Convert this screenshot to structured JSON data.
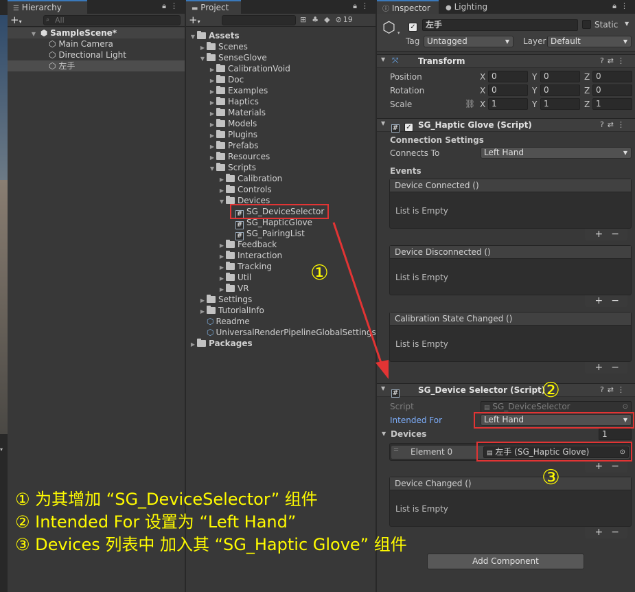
{
  "hierarchy": {
    "tab": "Hierarchy",
    "search_placeholder": "All",
    "scene": "SampleScene*",
    "items": [
      "Main Camera",
      "Directional Light",
      "左手"
    ]
  },
  "project": {
    "tab": "Project",
    "hidden_count": "19",
    "tree": [
      {
        "label": "Assets",
        "depth": 0,
        "expanded": true,
        "bold": true,
        "icon": "folder"
      },
      {
        "label": "Scenes",
        "depth": 1,
        "expanded": false,
        "icon": "folder"
      },
      {
        "label": "SenseGlove",
        "depth": 1,
        "expanded": true,
        "icon": "folder"
      },
      {
        "label": "CalibrationVoid",
        "depth": 2,
        "expanded": false,
        "icon": "folder"
      },
      {
        "label": "Doc",
        "depth": 2,
        "expanded": false,
        "icon": "folder"
      },
      {
        "label": "Examples",
        "depth": 2,
        "expanded": false,
        "icon": "folder"
      },
      {
        "label": "Haptics",
        "depth": 2,
        "expanded": false,
        "icon": "folder"
      },
      {
        "label": "Materials",
        "depth": 2,
        "expanded": false,
        "icon": "folder"
      },
      {
        "label": "Models",
        "depth": 2,
        "expanded": false,
        "icon": "folder"
      },
      {
        "label": "Plugins",
        "depth": 2,
        "expanded": false,
        "icon": "folder"
      },
      {
        "label": "Prefabs",
        "depth": 2,
        "expanded": false,
        "icon": "folder"
      },
      {
        "label": "Resources",
        "depth": 2,
        "expanded": false,
        "icon": "folder"
      },
      {
        "label": "Scripts",
        "depth": 2,
        "expanded": true,
        "icon": "folder"
      },
      {
        "label": "Calibration",
        "depth": 3,
        "expanded": false,
        "icon": "folder"
      },
      {
        "label": "Controls",
        "depth": 3,
        "expanded": false,
        "icon": "folder"
      },
      {
        "label": "Devices",
        "depth": 3,
        "expanded": true,
        "icon": "folder"
      },
      {
        "label": "SG_DeviceSelector",
        "depth": 4,
        "icon": "script"
      },
      {
        "label": "SG_HapticGlove",
        "depth": 4,
        "icon": "script"
      },
      {
        "label": "SG_PairingList",
        "depth": 4,
        "icon": "script"
      },
      {
        "label": "Feedback",
        "depth": 3,
        "expanded": false,
        "icon": "folder"
      },
      {
        "label": "Interaction",
        "depth": 3,
        "expanded": false,
        "icon": "folder"
      },
      {
        "label": "Tracking",
        "depth": 3,
        "expanded": false,
        "icon": "folder"
      },
      {
        "label": "Util",
        "depth": 3,
        "expanded": false,
        "icon": "folder"
      },
      {
        "label": "VR",
        "depth": 3,
        "expanded": false,
        "icon": "folder"
      },
      {
        "label": "Settings",
        "depth": 1,
        "expanded": false,
        "icon": "folder"
      },
      {
        "label": "TutorialInfo",
        "depth": 1,
        "expanded": false,
        "icon": "folder"
      },
      {
        "label": "Readme",
        "depth": 1,
        "icon": "asset"
      },
      {
        "label": "UniversalRenderPipelineGlobalSettings",
        "depth": 1,
        "icon": "asset"
      },
      {
        "label": "Packages",
        "depth": 0,
        "expanded": false,
        "bold": true,
        "icon": "folder"
      }
    ]
  },
  "inspector": {
    "tab": "Inspector",
    "tab2": "Lighting",
    "object_name": "左手",
    "static_label": "Static",
    "tag_label": "Tag",
    "tag_value": "Untagged",
    "layer_label": "Layer",
    "layer_value": "Default",
    "transform": {
      "title": "Transform",
      "rows": [
        {
          "label": "Position",
          "x": "0",
          "y": "0",
          "z": "0"
        },
        {
          "label": "Rotation",
          "x": "0",
          "y": "0",
          "z": "0"
        },
        {
          "label": "Scale",
          "x": "1",
          "y": "1",
          "z": "1"
        }
      ],
      "axis": [
        "X",
        "Y",
        "Z"
      ]
    },
    "haptic": {
      "title": "SG_Haptic Glove (Script)",
      "connection_settings": "Connection Settings",
      "connects_to_label": "Connects To",
      "connects_to_value": "Left Hand",
      "events_label": "Events",
      "events": [
        "Device Connected ()",
        "Device Disconnected ()",
        "Calibration State Changed ()"
      ],
      "empty": "List is Empty"
    },
    "selector": {
      "title": "SG_Device Selector (Script)",
      "script_label": "Script",
      "script_value": "SG_DeviceSelector",
      "intended_label": "Intended For",
      "intended_value": "Left Hand",
      "devices_label": "Devices",
      "devices_count": "1",
      "element_label": "Element 0",
      "element_value": "左手 (SG_Haptic Glove)",
      "event": "Device Changed ()",
      "empty": "List is Empty"
    },
    "add_component": "Add Component"
  },
  "annotations": {
    "markers": [
      "①",
      "②",
      "③"
    ],
    "notes": [
      "① 为其增加 “SG_DeviceSelector” 组件",
      "② Intended For 设置为 “Left Hand”",
      "③ Devices 列表中 加入其 “SG_Haptic Glove” 组件"
    ],
    "color": "#fffb00",
    "box_color": "#e23434"
  }
}
